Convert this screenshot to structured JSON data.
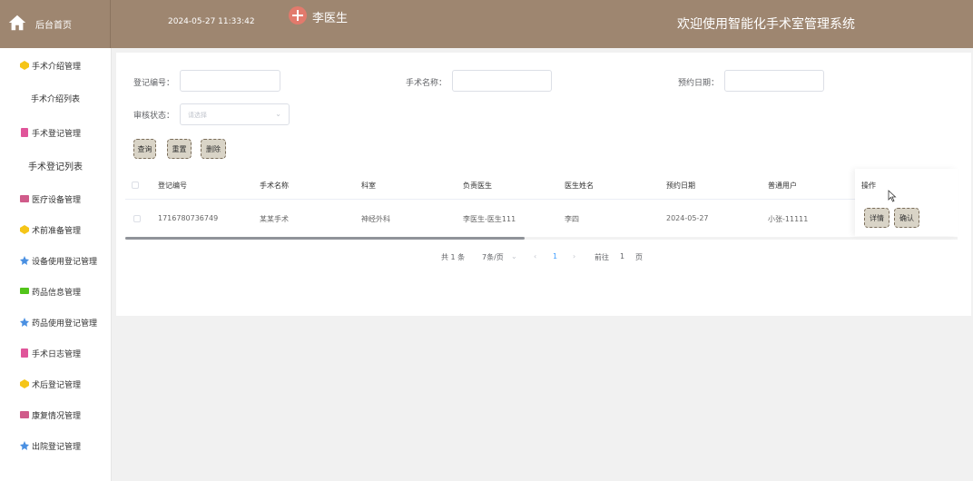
{
  "header": {
    "home_label": "后台首页",
    "datetime": "2024-05-27 11:33:42",
    "username": "李医生",
    "system_title": "欢迎使用智能化手术室管理系统"
  },
  "sidebar": {
    "items": [
      {
        "label": "手术介绍管理",
        "icon": "hexagon-icon",
        "color": "#f5c518"
      },
      {
        "label": "手术介绍列表",
        "sub": true
      },
      {
        "label": "手术登记管理",
        "icon": "doc-icon",
        "color": "#e0559a"
      },
      {
        "label": "手术登记列表",
        "sub": true
      },
      {
        "label": "医疗设备管理",
        "icon": "folder-icon",
        "color": "#d05b8a"
      },
      {
        "label": "术前准备管理",
        "icon": "hexagon-icon",
        "color": "#f5c518"
      },
      {
        "label": "设备使用登记管理",
        "icon": "star-icon",
        "color": "#4a90e2"
      },
      {
        "label": "药品信息管理",
        "icon": "message-icon",
        "color": "#52c41a"
      },
      {
        "label": "药品使用登记管理",
        "icon": "star-icon",
        "color": "#4a90e2"
      },
      {
        "label": "手术日志管理",
        "icon": "doc-icon",
        "color": "#e0559a"
      },
      {
        "label": "术后登记管理",
        "icon": "hexagon-icon",
        "color": "#f5c518"
      },
      {
        "label": "康复情况管理",
        "icon": "folder-icon",
        "color": "#d05b8a"
      },
      {
        "label": "出院登记管理",
        "icon": "star-icon",
        "color": "#4a90e2"
      }
    ]
  },
  "form": {
    "reg_no_label": "登记编号：",
    "reg_no_value": "",
    "surgery_name_label": "手术名称：",
    "surgery_name_value": "",
    "appt_date_label": "预约日期：",
    "appt_date_value": "",
    "status_label": "审核状态：",
    "status_placeholder": "请选择"
  },
  "buttons": {
    "search": "查询",
    "reset": "重置",
    "delete": "删除"
  },
  "table": {
    "headers": [
      "登记编号",
      "手术名称",
      "科室",
      "负责医生",
      "医生姓名",
      "预约日期",
      "普通用户",
      "操作"
    ],
    "rows": [
      [
        "1716780736749",
        "某某手术",
        "神经外科",
        "李医生-医生111",
        "李四",
        "2024-05-27",
        "小张-11111"
      ]
    ],
    "row_actions": [
      "详情",
      "确认"
    ]
  },
  "pagination": {
    "total": "共 1 条",
    "page_size": "7条/页",
    "current_page": "1",
    "goto_label": "前往",
    "goto_value": "1",
    "page_suffix": "页"
  }
}
